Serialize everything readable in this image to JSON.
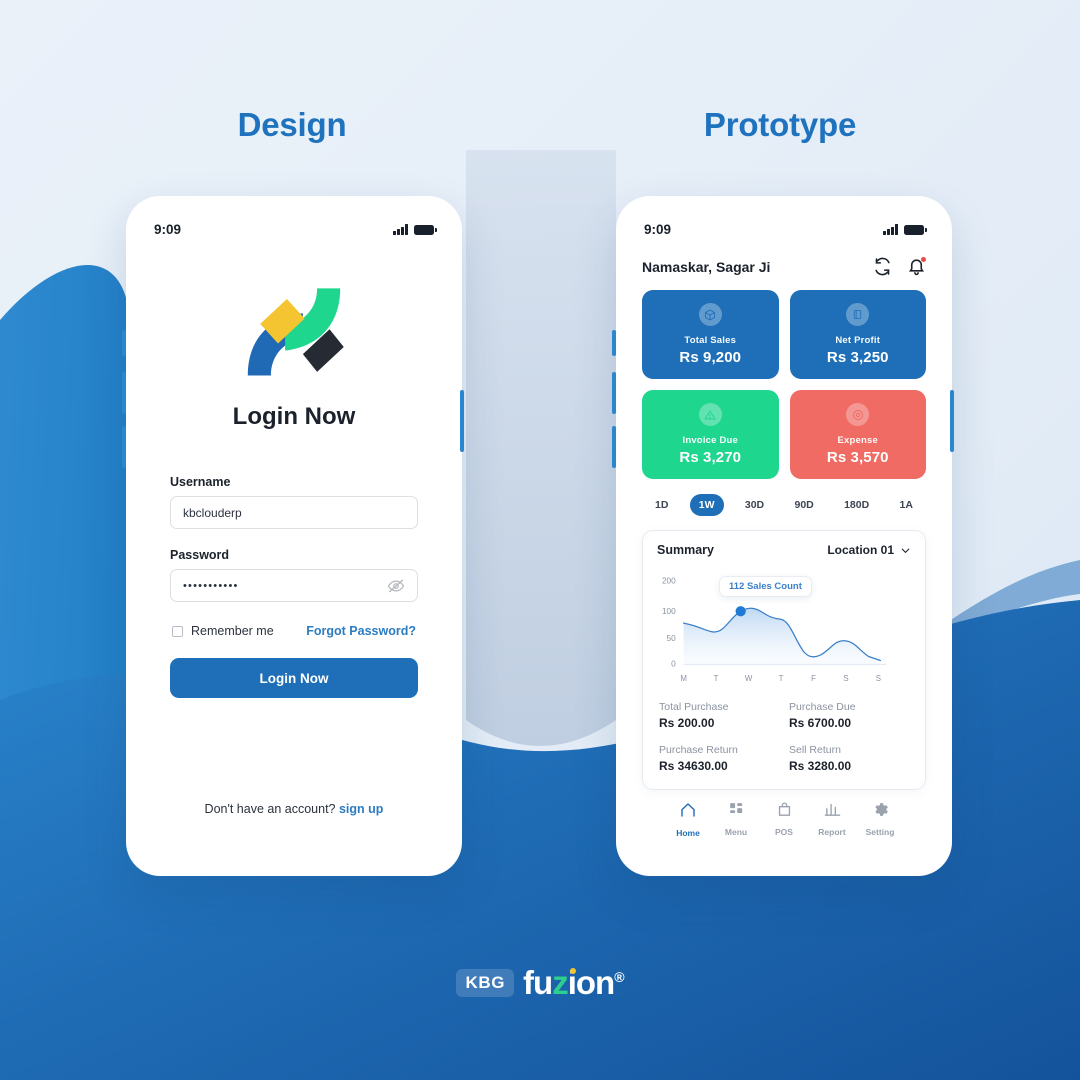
{
  "headings": {
    "design": "Design",
    "prototype": "Prototype"
  },
  "colors": {
    "brand_blue": "#1e6fb8",
    "accent_blue": "#2c7cc2",
    "card_blue": "#1e6fb8",
    "card_green": "#1fd68f",
    "card_red": "#ef6b63",
    "bg_light": "#e8eff8",
    "wave_blue": "#1a5fa8",
    "logo_yellow": "#f5c431",
    "logo_green": "#1fd68f",
    "logo_dark": "#262b33"
  },
  "login_screen": {
    "status_bar": {
      "time": "9:09",
      "signal_icon": "signal-bars-icon",
      "battery_icon": "battery-icon"
    },
    "logo_icon": "kbg-fuzion-mark-icon",
    "title": "Login Now",
    "username": {
      "label": "Username",
      "value": "kbclouderp",
      "placeholder": "Username"
    },
    "password": {
      "label": "Password",
      "value": "•••••••••••",
      "placeholder": "Password",
      "toggle_icon": "eye-off-icon"
    },
    "remember_me": "Remember me",
    "forgot_password": "Forgot Password?",
    "submit_button": "Login Now",
    "signup_prompt": "Don't have an account? ",
    "signup_link": "sign up"
  },
  "dashboard": {
    "status_bar": {
      "time": "9:09",
      "signal_icon": "signal-bars-icon",
      "battery_icon": "battery-icon"
    },
    "greeting": "Namaskar, Sagar Ji",
    "refresh_icon": "refresh-icon",
    "notification_icon": "bell-icon",
    "metric_cards": [
      {
        "title": "Total Sales",
        "value": "Rs 9,200",
        "color": "#1e6fb8",
        "icon": "cube-icon"
      },
      {
        "title": "Net Profit",
        "value": "Rs 3,250",
        "color": "#1e6fb8",
        "icon": "book-icon"
      },
      {
        "title": "Invoice Due",
        "value": "Rs 3,270",
        "color": "#1fd68f",
        "icon": "alert-triangle-icon"
      },
      {
        "title": "Expense",
        "value": "Rs 3,570",
        "color": "#ef6b63",
        "icon": "target-icon"
      }
    ],
    "range_filters": [
      {
        "label": "1D",
        "active": false
      },
      {
        "label": "1W",
        "active": true
      },
      {
        "label": "30D",
        "active": false
      },
      {
        "label": "90D",
        "active": false
      },
      {
        "label": "180D",
        "active": false
      },
      {
        "label": "1A",
        "active": false
      }
    ],
    "summary": {
      "title": "Summary",
      "location": "Location 01",
      "location_chevron_icon": "chevron-down-icon"
    },
    "stats": [
      {
        "label": "Total Purchase",
        "value": "Rs 200.00"
      },
      {
        "label": "Purchase Due",
        "value": "Rs 6700.00"
      },
      {
        "label": "Purchase Return",
        "value": "Rs 34630.00"
      },
      {
        "label": "Sell Return",
        "value": "Rs 3280.00"
      }
    ],
    "tabs": [
      {
        "label": "Home",
        "icon": "home-icon",
        "active": true
      },
      {
        "label": "Menu",
        "icon": "grid-icon",
        "active": false
      },
      {
        "label": "POS",
        "icon": "bag-icon",
        "active": false
      },
      {
        "label": "Report",
        "icon": "chart-icon",
        "active": false
      },
      {
        "label": "Setting",
        "icon": "gear-icon",
        "active": false
      }
    ]
  },
  "chart_data": {
    "type": "area",
    "title": "Summary",
    "categories": [
      "M",
      "T",
      "W",
      "T",
      "F",
      "S",
      "S"
    ],
    "values": [
      78,
      62,
      112,
      88,
      18,
      45,
      15
    ],
    "yticks": [
      0,
      50,
      100,
      200
    ],
    "ylim": [
      0,
      200
    ],
    "xlabel": "",
    "ylabel": "",
    "grid": false,
    "legend": "none",
    "annotation": {
      "text": "112 Sales Count",
      "at_category": "W",
      "at_value": 112
    },
    "line_color": "#3b80c9",
    "fill_color": "#dbe8f7",
    "marker_color": "#1f7ad4"
  },
  "footer": {
    "badge": "KBG",
    "brand_f": "fu",
    "brand_z": "z",
    "brand_i": "i",
    "brand_on": "on",
    "registered": "®"
  }
}
